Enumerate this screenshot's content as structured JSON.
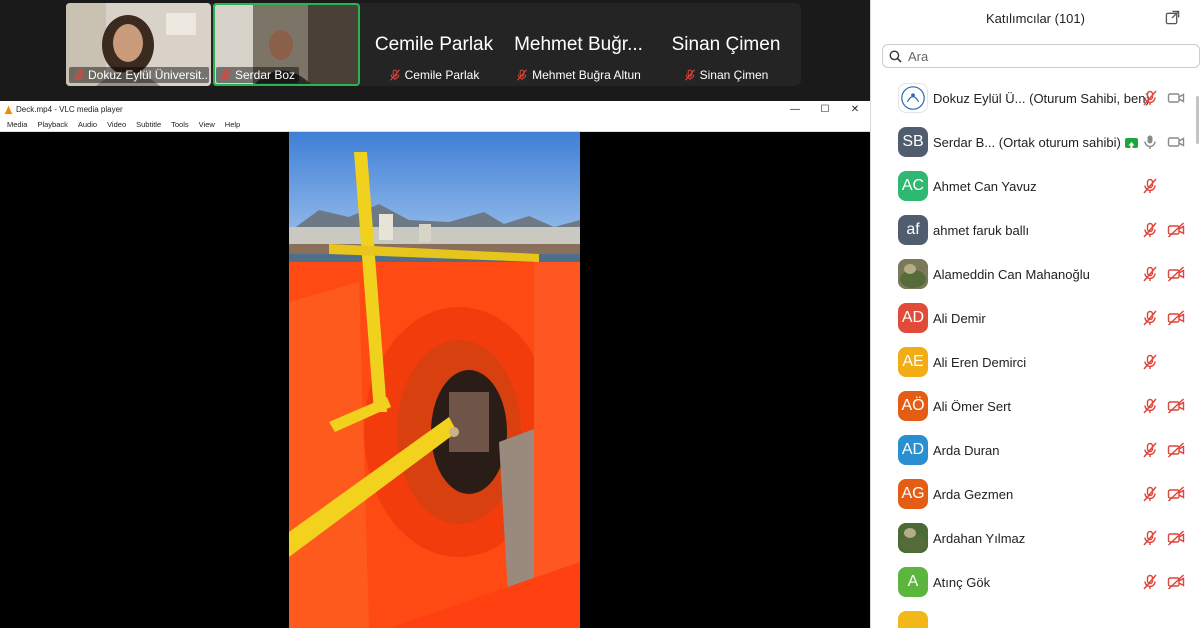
{
  "tiles": [
    {
      "name": "Dokuz Eylül Üniversit...",
      "type": "video"
    },
    {
      "name": "Serdar Boz",
      "type": "video",
      "active": true
    },
    {
      "display_name": "Cemile Parlak",
      "name": "Cemile Parlak",
      "type": "name"
    },
    {
      "display_name": "Mehmet Buğr...",
      "name": "Mehmet Buğra Altun",
      "type": "name"
    },
    {
      "display_name": "Sinan Çimen",
      "name": "Sinan Çimen",
      "type": "name"
    }
  ],
  "vlc": {
    "title": "Deck.mp4 - VLC media player",
    "menu": [
      "Media",
      "Playback",
      "Audio",
      "Video",
      "Subtitle",
      "Tools",
      "View",
      "Help"
    ],
    "minimize": "—",
    "maximize": "☐",
    "close": "✕"
  },
  "panel": {
    "title": "Katılımcılar (101)",
    "search_placeholder": "Ara"
  },
  "participants": [
    {
      "initials": "",
      "name": "Dokuz Eylül Ü...",
      "role": "(Oturum Sahibi, ben)",
      "avatar_color": "#ffffff",
      "mic": "muted",
      "camera": "on-grey",
      "logo": true
    },
    {
      "initials": "SB",
      "name": "Serdar B...",
      "role": "(Ortak oturum sahibi)",
      "avatar_color": "#4f5d6e",
      "mic": "on",
      "camera": "on-grey",
      "sharing": true
    },
    {
      "initials": "AC",
      "name": "Ahmet Can Yavuz",
      "role": "",
      "avatar_color": "#2fb872",
      "mic": "muted",
      "camera": "none"
    },
    {
      "initials": "af",
      "name": "ahmet faruk ballı",
      "role": "",
      "avatar_color": "#4f5d6e",
      "mic": "muted",
      "camera": "off"
    },
    {
      "initials": "",
      "name": "Alameddin Can Mahanoğlu",
      "role": "",
      "avatar_color": "#7a7a5a",
      "mic": "muted",
      "camera": "off",
      "photo": true
    },
    {
      "initials": "AD",
      "name": "Ali Demir",
      "role": "",
      "avatar_color": "#e04b3a",
      "mic": "muted",
      "camera": "off"
    },
    {
      "initials": "AE",
      "name": "Ali Eren Demirci",
      "role": "",
      "avatar_color": "#f2ad14",
      "mic": "muted",
      "camera": "none"
    },
    {
      "initials": "AÖ",
      "name": "Ali Ömer Sert",
      "role": "",
      "avatar_color": "#e35d15",
      "mic": "muted",
      "camera": "off"
    },
    {
      "initials": "AD",
      "name": "Arda Duran",
      "role": "",
      "avatar_color": "#2a8fd0",
      "mic": "muted",
      "camera": "off"
    },
    {
      "initials": "AG",
      "name": "Arda Gezmen",
      "role": "",
      "avatar_color": "#e35d15",
      "mic": "muted",
      "camera": "off"
    },
    {
      "initials": "",
      "name": "Ardahan Yılmaz",
      "role": "",
      "avatar_color": "#4b6b35",
      "mic": "muted",
      "camera": "off",
      "photo": true
    },
    {
      "initials": "A",
      "name": "Atınç Gök",
      "role": "",
      "avatar_color": "#5cb53d",
      "mic": "muted",
      "camera": "off"
    },
    {
      "initials": "",
      "name": "",
      "role": "",
      "avatar_color": "#f2b818",
      "mic": "none",
      "camera": "none"
    }
  ],
  "colors": {
    "mic_muted": "#e0443a",
    "accent_green": "#2bb352",
    "icon_grey": "#8a8a8a"
  }
}
